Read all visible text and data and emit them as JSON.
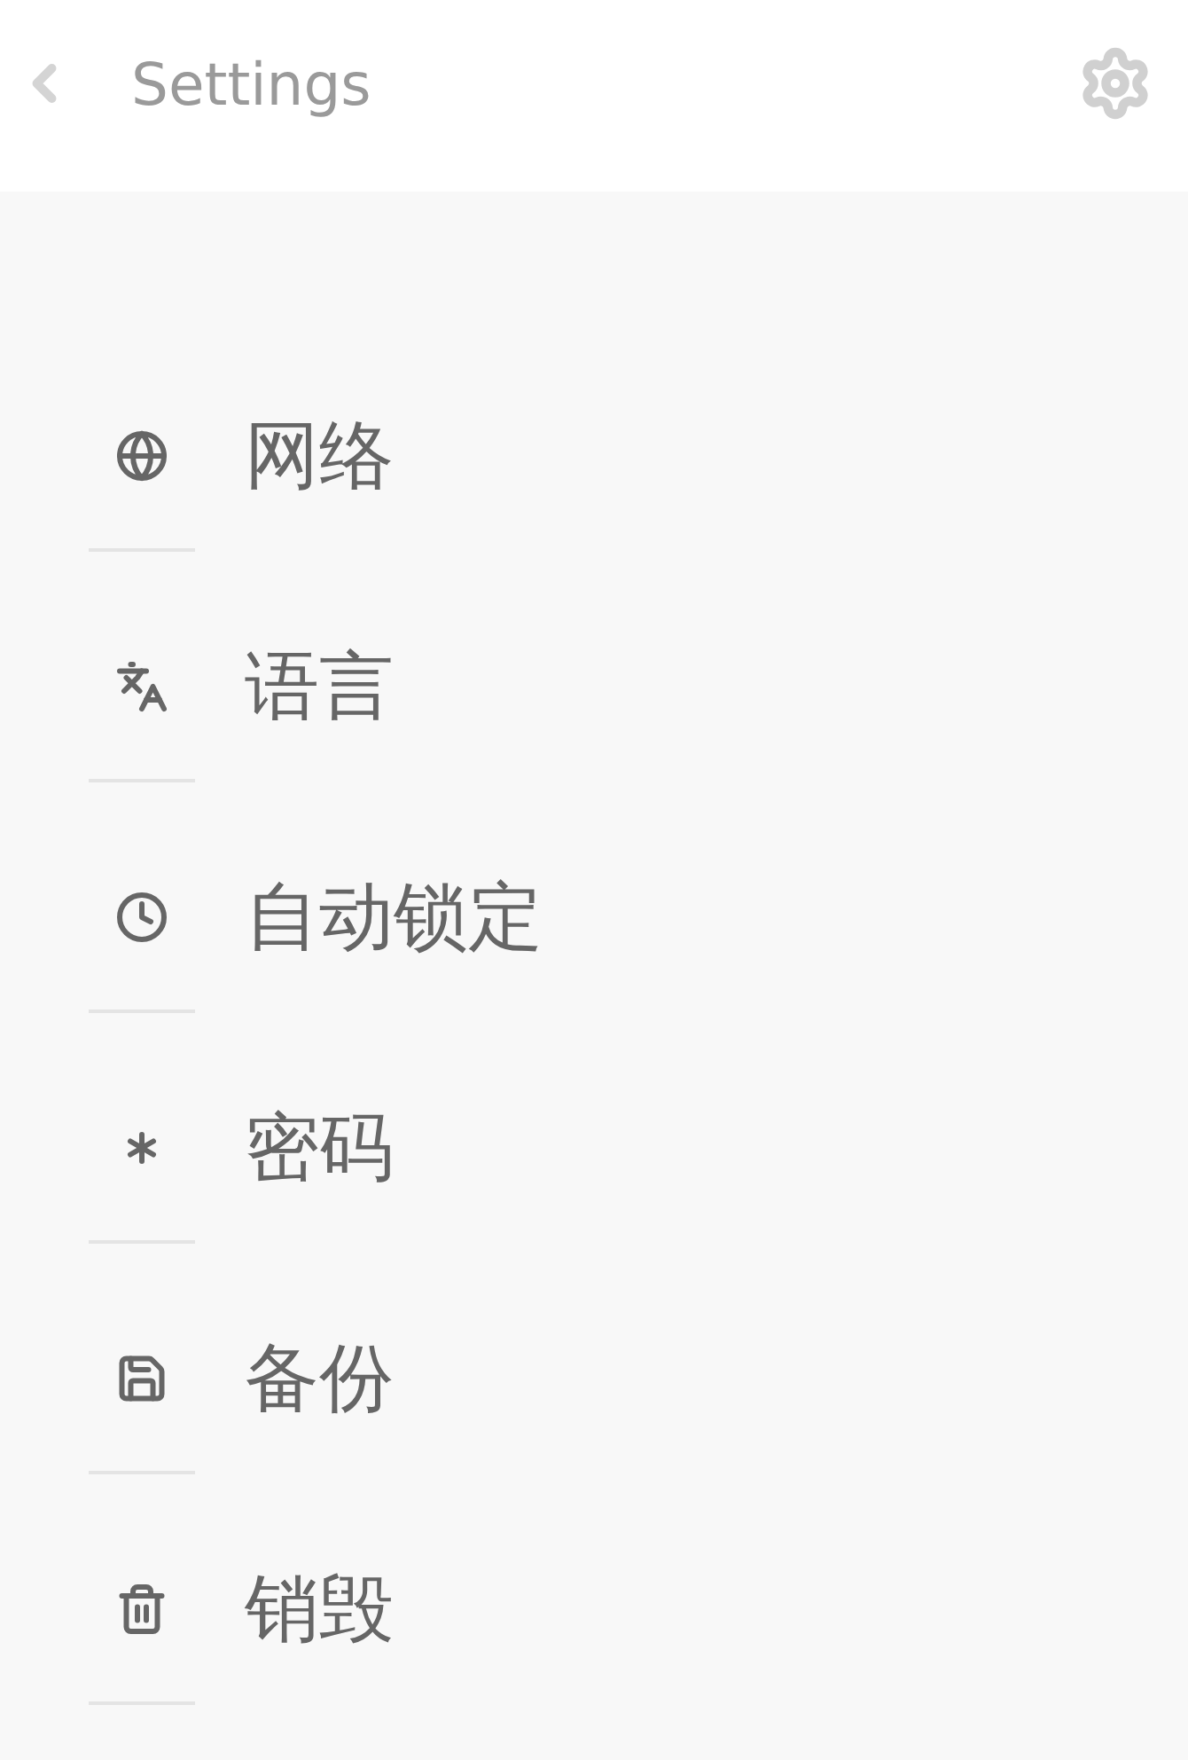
{
  "header": {
    "title": "Settings"
  },
  "items": [
    {
      "label": "网络"
    },
    {
      "label": "语言"
    },
    {
      "label": "自动锁定"
    },
    {
      "label": "密码"
    },
    {
      "label": "备份"
    },
    {
      "label": "销毁"
    }
  ]
}
